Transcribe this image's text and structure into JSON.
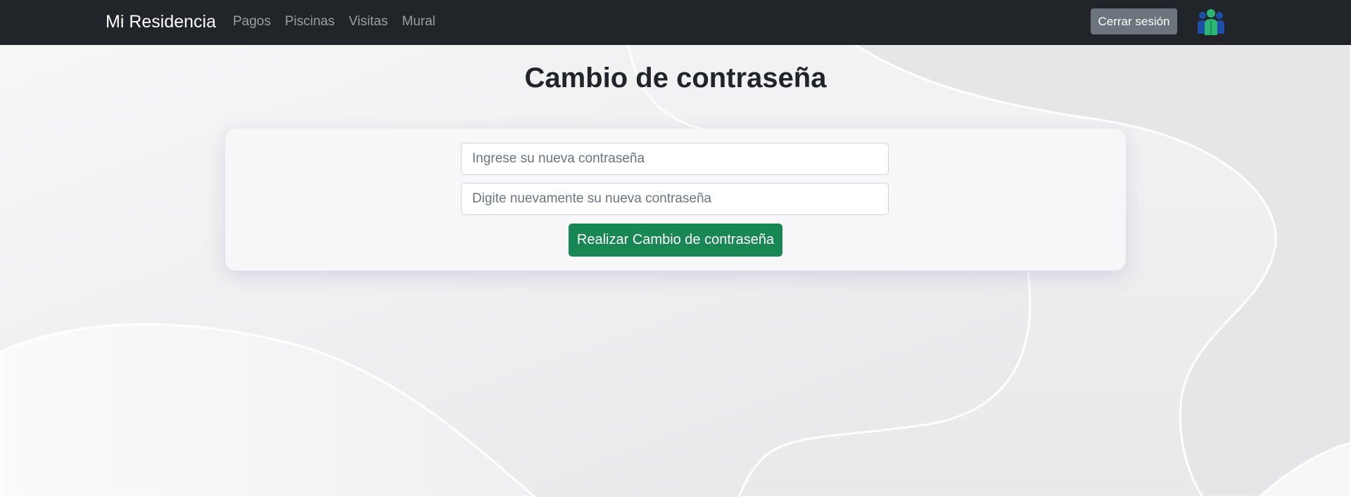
{
  "navbar": {
    "brand": "Mi Residencia",
    "links": [
      {
        "label": "Pagos"
      },
      {
        "label": "Piscinas"
      },
      {
        "label": "Visitas"
      },
      {
        "label": "Mural"
      }
    ],
    "logout_label": "Cerrar sesión",
    "avatar_icon": "users-group-icon",
    "background_color": "#212529"
  },
  "page": {
    "title": "Cambio de contraseña"
  },
  "form": {
    "new_password": {
      "placeholder": "Ingrese su nueva contraseña",
      "value": ""
    },
    "confirm_password": {
      "placeholder": "Digite nuevamente su nueva contraseña",
      "value": ""
    },
    "submit_label": "Realizar Cambio de contraseña",
    "submit_color": "#198754"
  }
}
